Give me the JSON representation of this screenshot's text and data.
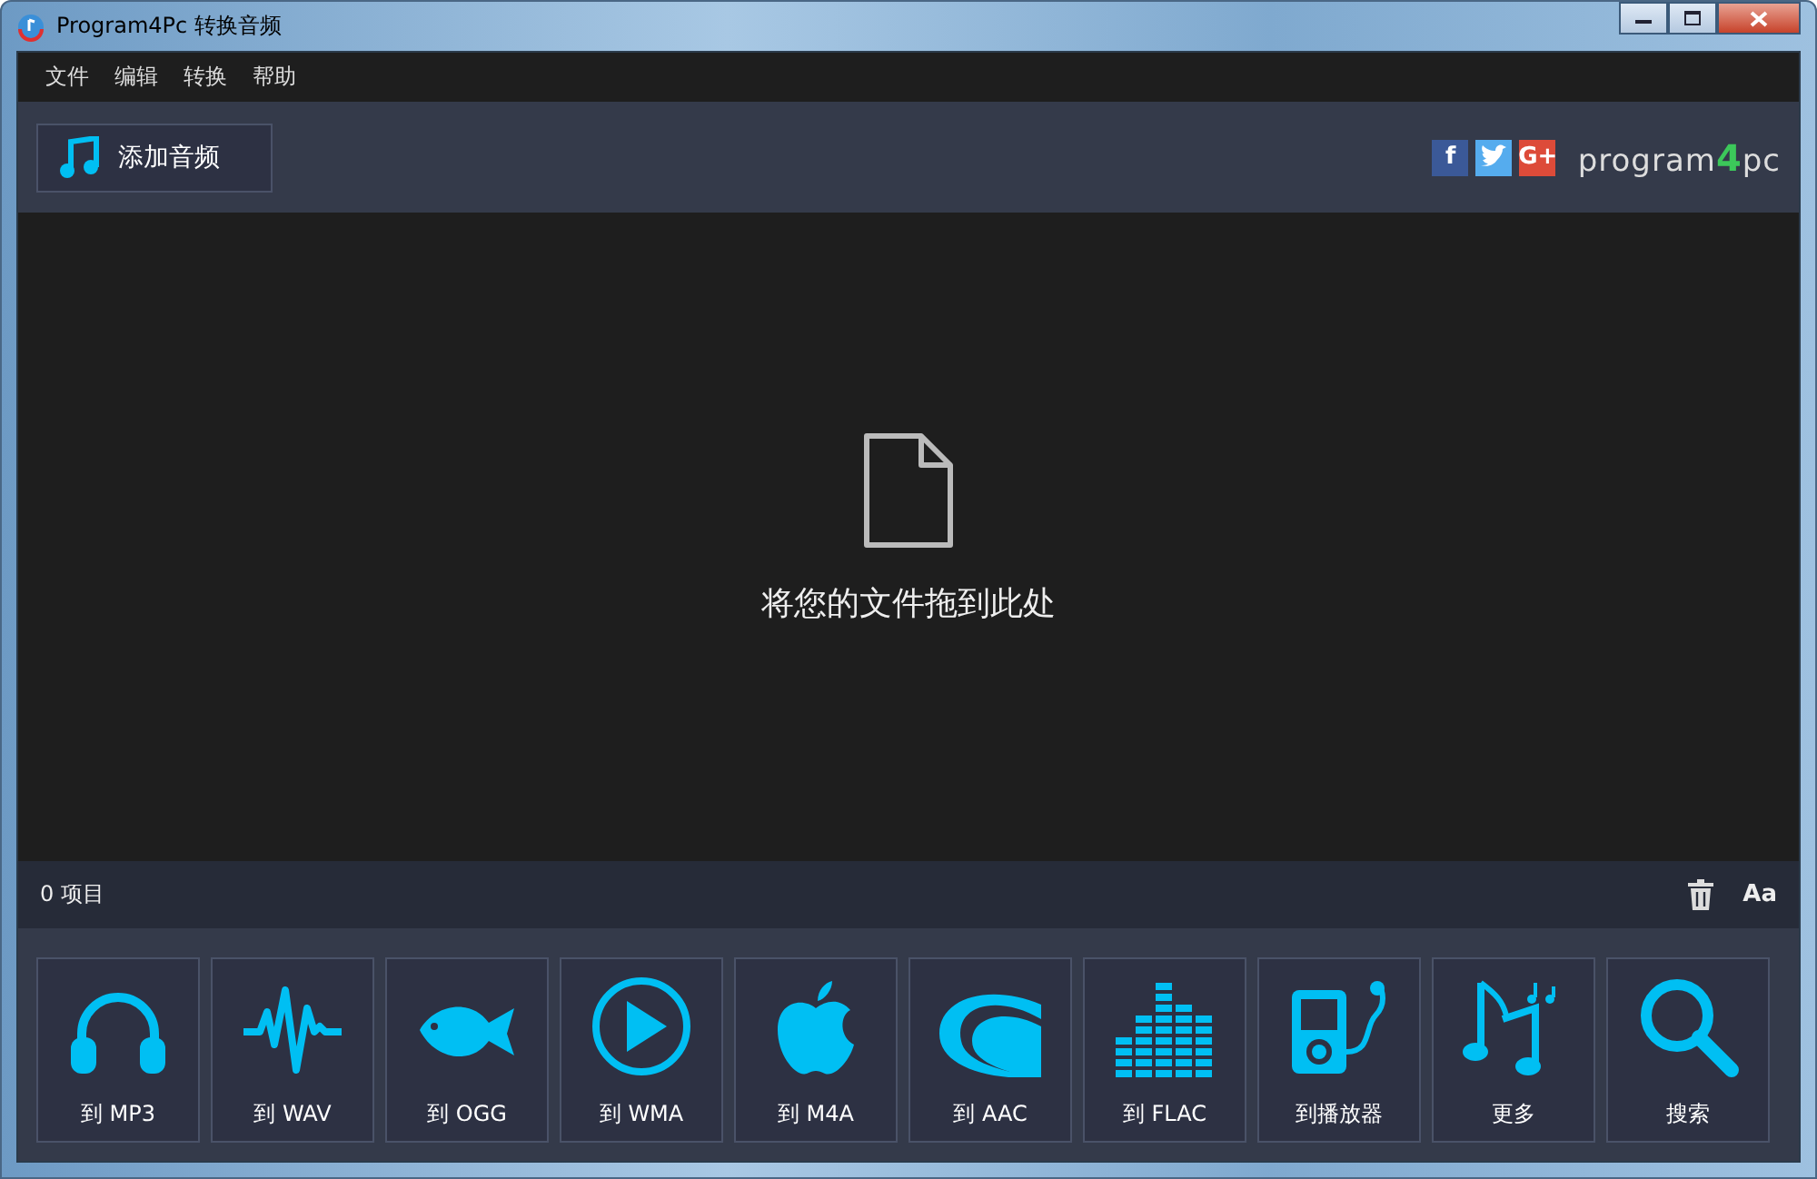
{
  "window": {
    "title": "Program4Pc 转换音频"
  },
  "menu": [
    "文件",
    "编辑",
    "转换",
    "帮助"
  ],
  "toolbar": {
    "add_button": "添加音频",
    "social": [
      {
        "kind": "f",
        "glyph": "f",
        "color": "#3b5998"
      },
      {
        "kind": "bird",
        "color": "#55acee"
      },
      {
        "kind": "g",
        "glyph": "G+",
        "color": "#dd4b39"
      }
    ],
    "logo": [
      "program",
      "4",
      "pc"
    ]
  },
  "drop_area": {
    "message": "将您的文件拖到此处"
  },
  "status_bar": {
    "count": "0  项目",
    "font_button": "Aa"
  },
  "actions": [
    {
      "kind": "headphones",
      "label": "到 MP3"
    },
    {
      "kind": "wave",
      "label": "到 WAV"
    },
    {
      "kind": "fish",
      "label": "到 OGG"
    },
    {
      "kind": "play",
      "label": "到 WMA"
    },
    {
      "kind": "apple",
      "label": "到 M4A"
    },
    {
      "kind": "arcs",
      "label": "到 AAC"
    },
    {
      "kind": "bars",
      "label": "到 FLAC"
    },
    {
      "kind": "player",
      "label": "到播放器"
    },
    {
      "kind": "notes",
      "label": "更多"
    },
    {
      "kind": "search",
      "label": "搜索"
    }
  ]
}
